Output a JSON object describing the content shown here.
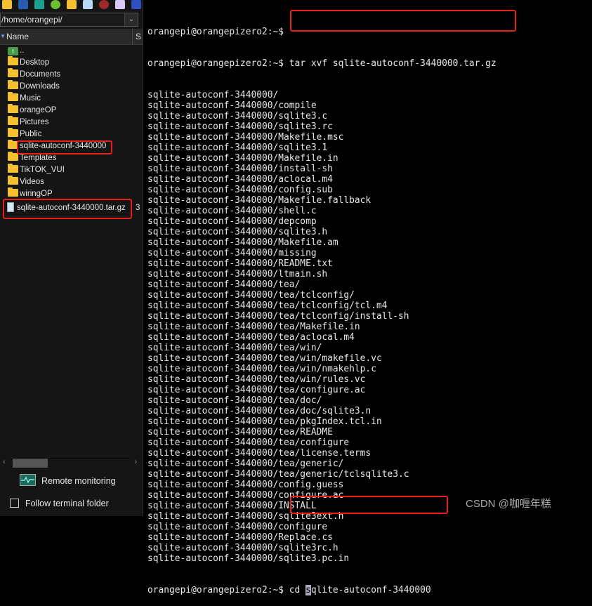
{
  "toolbar": {
    "icons": [
      {
        "name": "upload-icon",
        "color": "#f5c030"
      },
      {
        "name": "download-icon",
        "color": "#2a5ab0"
      },
      {
        "name": "upload-arrow-icon",
        "color": "#1aa090"
      },
      {
        "name": "refresh-icon",
        "color": "#6cc030"
      },
      {
        "name": "new-folder-icon",
        "color": "#f5c030"
      },
      {
        "name": "new-file-icon",
        "color": "#b8d8f8"
      },
      {
        "name": "delete-icon",
        "color": "#a02a2a"
      },
      {
        "name": "rename-icon",
        "color": "#d8c8f8"
      },
      {
        "name": "properties-icon",
        "color": "#3050c0"
      }
    ]
  },
  "path": "/home/orangepi/",
  "columns": {
    "name": "Name",
    "size": "S"
  },
  "files": [
    {
      "name": "..",
      "type": "up"
    },
    {
      "name": "Desktop",
      "type": "folder"
    },
    {
      "name": "Documents",
      "type": "folder"
    },
    {
      "name": "Downloads",
      "type": "folder"
    },
    {
      "name": "Music",
      "type": "folder"
    },
    {
      "name": "orangeOP",
      "type": "folder"
    },
    {
      "name": "Pictures",
      "type": "folder"
    },
    {
      "name": "Public",
      "type": "folder"
    },
    {
      "name": "sqlite-autoconf-3440000",
      "type": "folder",
      "highlighted": true
    },
    {
      "name": "Templates",
      "type": "folder"
    },
    {
      "name": "TikTOK_VUI",
      "type": "folder"
    },
    {
      "name": "Videos",
      "type": "folder"
    },
    {
      "name": "wiringOP",
      "type": "folder"
    },
    {
      "name": "sqlite-autoconf-3440000.tar.gz",
      "type": "file",
      "size": "3",
      "highlighted": true
    }
  ],
  "remote_monitoring": "Remote monitoring",
  "follow_terminal": {
    "label": "Follow terminal folder",
    "checked": false
  },
  "terminal": {
    "prompt": "orangepi@orangepizero2:~$",
    "command1": "tar xvf sqlite-autoconf-3440000.tar.gz",
    "output": [
      "sqlite-autoconf-3440000/",
      "sqlite-autoconf-3440000/compile",
      "sqlite-autoconf-3440000/sqlite3.c",
      "sqlite-autoconf-3440000/sqlite3.rc",
      "sqlite-autoconf-3440000/Makefile.msc",
      "sqlite-autoconf-3440000/sqlite3.1",
      "sqlite-autoconf-3440000/Makefile.in",
      "sqlite-autoconf-3440000/install-sh",
      "sqlite-autoconf-3440000/aclocal.m4",
      "sqlite-autoconf-3440000/config.sub",
      "sqlite-autoconf-3440000/Makefile.fallback",
      "sqlite-autoconf-3440000/shell.c",
      "sqlite-autoconf-3440000/depcomp",
      "sqlite-autoconf-3440000/sqlite3.h",
      "sqlite-autoconf-3440000/Makefile.am",
      "sqlite-autoconf-3440000/missing",
      "sqlite-autoconf-3440000/README.txt",
      "sqlite-autoconf-3440000/ltmain.sh",
      "sqlite-autoconf-3440000/tea/",
      "sqlite-autoconf-3440000/tea/tclconfig/",
      "sqlite-autoconf-3440000/tea/tclconfig/tcl.m4",
      "sqlite-autoconf-3440000/tea/tclconfig/install-sh",
      "sqlite-autoconf-3440000/tea/Makefile.in",
      "sqlite-autoconf-3440000/tea/aclocal.m4",
      "sqlite-autoconf-3440000/tea/win/",
      "sqlite-autoconf-3440000/tea/win/makefile.vc",
      "sqlite-autoconf-3440000/tea/win/nmakehlp.c",
      "sqlite-autoconf-3440000/tea/win/rules.vc",
      "sqlite-autoconf-3440000/tea/configure.ac",
      "sqlite-autoconf-3440000/tea/doc/",
      "sqlite-autoconf-3440000/tea/doc/sqlite3.n",
      "sqlite-autoconf-3440000/tea/pkgIndex.tcl.in",
      "sqlite-autoconf-3440000/tea/README",
      "sqlite-autoconf-3440000/tea/configure",
      "sqlite-autoconf-3440000/tea/license.terms",
      "sqlite-autoconf-3440000/tea/generic/",
      "sqlite-autoconf-3440000/tea/generic/tclsqlite3.c",
      "sqlite-autoconf-3440000/config.guess",
      "sqlite-autoconf-3440000/configure.ac",
      "sqlite-autoconf-3440000/INSTALL",
      "sqlite-autoconf-3440000/sqlite3ext.h",
      "sqlite-autoconf-3440000/configure",
      "sqlite-autoconf-3440000/Replace.cs",
      "sqlite-autoconf-3440000/sqlite3rc.h",
      "sqlite-autoconf-3440000/sqlite3.pc.in"
    ],
    "command2_prefix": "cd ",
    "command2_cursor_char": "s",
    "command2_rest": "qlite-autoconf-3440000"
  },
  "watermark": "CSDN @咖喱年糕",
  "colors": {
    "highlight": "#e8201c",
    "folder": "#f5c030",
    "terminal_bg": "#000000",
    "terminal_fg": "#e8e8e8"
  }
}
